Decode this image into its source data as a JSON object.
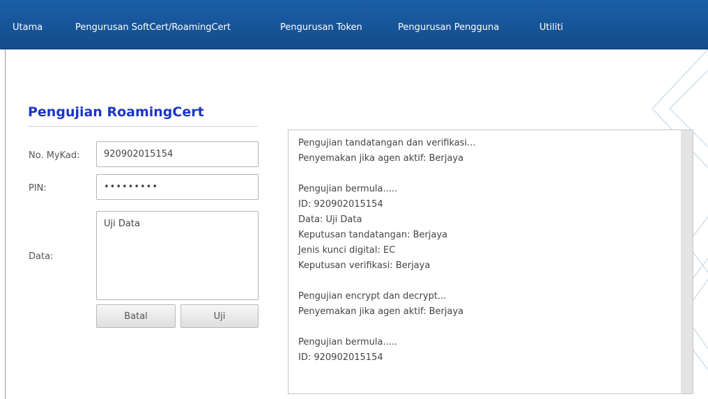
{
  "nav": {
    "items": [
      {
        "label": "Utama"
      },
      {
        "label": "Pengurusan SoftCert/RoamingCert"
      },
      {
        "label": "Pengurusan Token"
      },
      {
        "label": "Pengurusan Pengguna"
      },
      {
        "label": "Utiliti"
      }
    ],
    "background_color": "#1b5fa8"
  },
  "form": {
    "title": "Pengujian RoamingCert",
    "title_color": "#1a35c8",
    "mykad_label": "No. MyKad:",
    "mykad_value": "920902015154",
    "pin_label": "PIN:",
    "pin_value": "•••••••••",
    "data_label": "Data:",
    "data_value": "Uji Data",
    "cancel_label": "Batal",
    "test_label": "Uji"
  },
  "output": {
    "lines": [
      "Pengujian tandatangan dan verifikasi...",
      "Penyemakan jika agen aktif: Berjaya",
      "",
      "Pengujian bermula.....",
      "ID: 920902015154",
      "Data: Uji Data",
      "Keputusan tandatangan: Berjaya",
      "Jenis kunci digital: EC",
      "Keputusan verifikasi: Berjaya",
      "",
      "Pengujian encrypt dan decrypt...",
      "Penyemakan jika agen aktif: Berjaya",
      "",
      "Pengujian bermula.....",
      "ID: 920902015154"
    ]
  }
}
